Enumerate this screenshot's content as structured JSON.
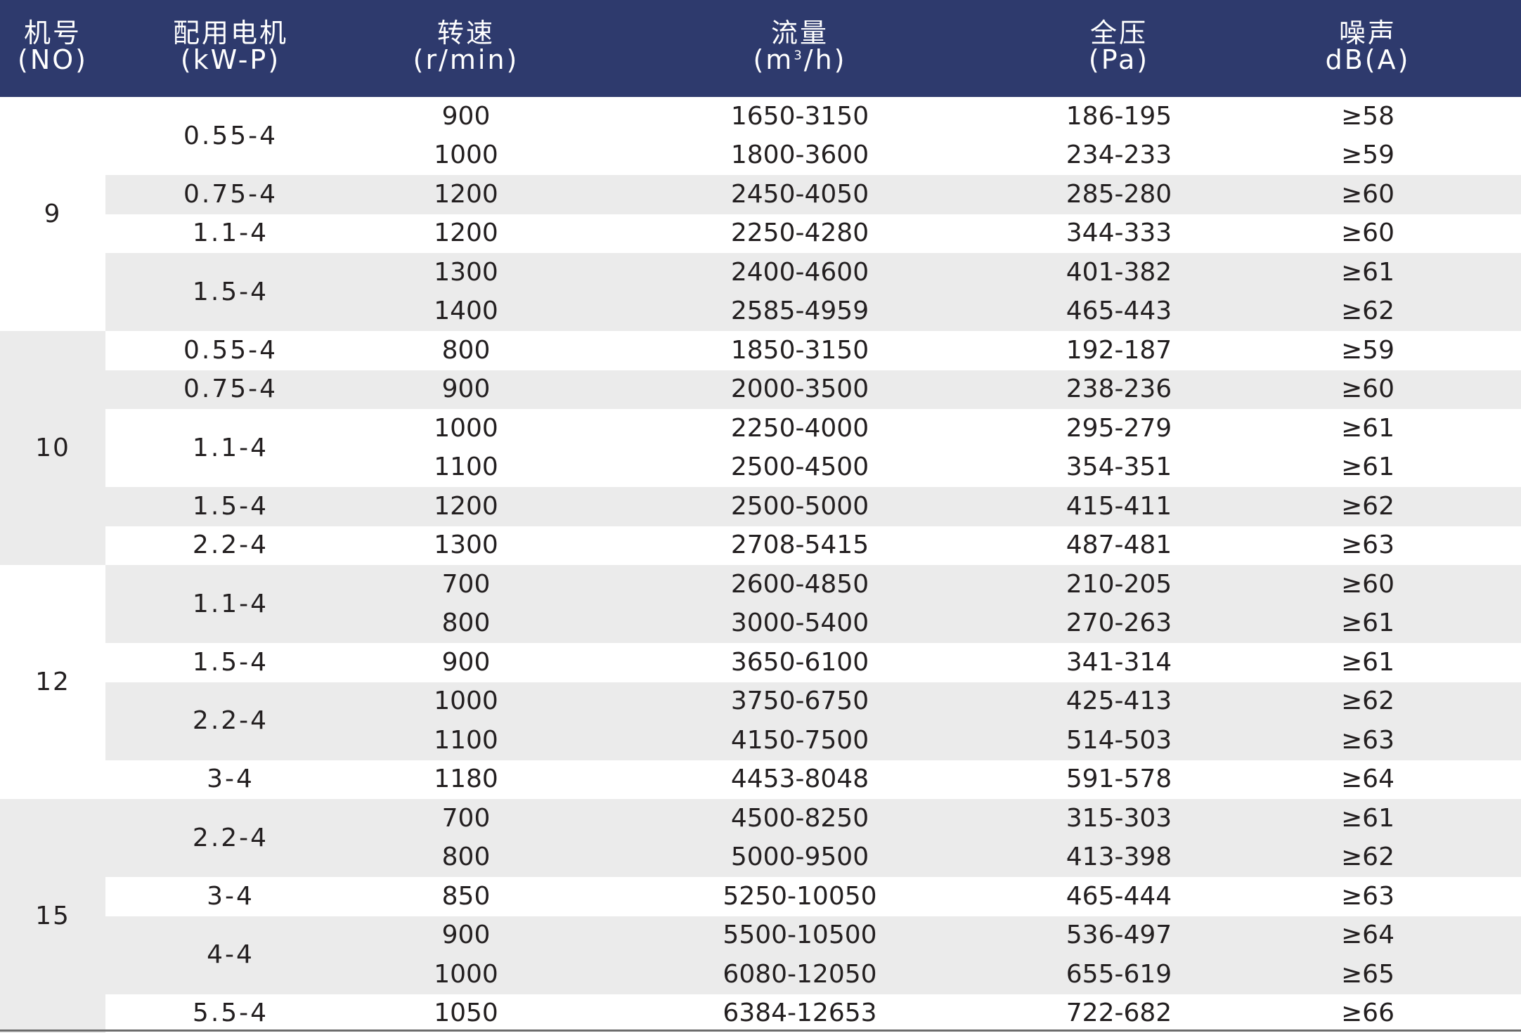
{
  "header": {
    "columns": [
      {
        "line1": "机号",
        "line2": "(NO)"
      },
      {
        "line1": "配用电机",
        "line2": "(kW-P)"
      },
      {
        "line1": "转速",
        "line2": "(r/min)"
      },
      {
        "line1": "流量",
        "line2_pre": "(m",
        "line2_sup": "3",
        "line2_post": "/h)"
      },
      {
        "line1": "全压",
        "line2": "(Pa)"
      },
      {
        "line1": "噪声",
        "line2": "dB(A)"
      }
    ]
  },
  "colors": {
    "header_bg": "#2e3a6d",
    "band_bg": "#ebebeb",
    "text": "#231f20"
  },
  "groups": [
    {
      "no": "9",
      "shaded": false,
      "motors": [
        {
          "motor": "0.55-4",
          "rows": [
            {
              "speed": "900",
              "flow": "1650-3150",
              "pressure": "186-195",
              "noise": "≥58"
            },
            {
              "speed": "1000",
              "flow": "1800-3600",
              "pressure": "234-233",
              "noise": "≥59"
            }
          ]
        },
        {
          "motor": "0.75-4",
          "rows": [
            {
              "speed": "1200",
              "flow": "2450-4050",
              "pressure": "285-280",
              "noise": "≥60"
            }
          ]
        },
        {
          "motor": "1.1-4",
          "rows": [
            {
              "speed": "1200",
              "flow": "2250-4280",
              "pressure": "344-333",
              "noise": "≥60"
            }
          ]
        },
        {
          "motor": "1.5-4",
          "rows": [
            {
              "speed": "1300",
              "flow": "2400-4600",
              "pressure": "401-382",
              "noise": "≥61"
            },
            {
              "speed": "1400",
              "flow": "2585-4959",
              "pressure": "465-443",
              "noise": "≥62"
            }
          ]
        }
      ]
    },
    {
      "no": "10",
      "shaded": true,
      "motors": [
        {
          "motor": "0.55-4",
          "rows": [
            {
              "speed": "800",
              "flow": "1850-3150",
              "pressure": "192-187",
              "noise": "≥59"
            }
          ]
        },
        {
          "motor": "0.75-4",
          "rows": [
            {
              "speed": "900",
              "flow": "2000-3500",
              "pressure": "238-236",
              "noise": "≥60"
            }
          ]
        },
        {
          "motor": "1.1-4",
          "rows": [
            {
              "speed": "1000",
              "flow": "2250-4000",
              "pressure": "295-279",
              "noise": "≥61"
            },
            {
              "speed": "1100",
              "flow": "2500-4500",
              "pressure": "354-351",
              "noise": "≥61"
            }
          ]
        },
        {
          "motor": "1.5-4",
          "rows": [
            {
              "speed": "1200",
              "flow": "2500-5000",
              "pressure": "415-411",
              "noise": "≥62"
            }
          ]
        },
        {
          "motor": "2.2-4",
          "rows": [
            {
              "speed": "1300",
              "flow": "2708-5415",
              "pressure": "487-481",
              "noise": "≥63"
            }
          ]
        }
      ]
    },
    {
      "no": "12",
      "shaded": false,
      "motors": [
        {
          "motor": "1.1-4",
          "rows": [
            {
              "speed": "700",
              "flow": "2600-4850",
              "pressure": "210-205",
              "noise": "≥60"
            },
            {
              "speed": "800",
              "flow": "3000-5400",
              "pressure": "270-263",
              "noise": "≥61"
            }
          ]
        },
        {
          "motor": "1.5-4",
          "rows": [
            {
              "speed": "900",
              "flow": "3650-6100",
              "pressure": "341-314",
              "noise": "≥61"
            }
          ]
        },
        {
          "motor": "2.2-4",
          "rows": [
            {
              "speed": "1000",
              "flow": "3750-6750",
              "pressure": "425-413",
              "noise": "≥62"
            },
            {
              "speed": "1100",
              "flow": "4150-7500",
              "pressure": "514-503",
              "noise": "≥63"
            }
          ]
        },
        {
          "motor": "3-4",
          "rows": [
            {
              "speed": "1180",
              "flow": "4453-8048",
              "pressure": "591-578",
              "noise": "≥64"
            }
          ]
        }
      ]
    },
    {
      "no": "15",
      "shaded": true,
      "motors": [
        {
          "motor": "2.2-4",
          "rows": [
            {
              "speed": "700",
              "flow": "4500-8250",
              "pressure": "315-303",
              "noise": "≥61"
            },
            {
              "speed": "800",
              "flow": "5000-9500",
              "pressure": "413-398",
              "noise": "≥62"
            }
          ]
        },
        {
          "motor": "3-4",
          "rows": [
            {
              "speed": "850",
              "flow": "5250-10050",
              "pressure": "465-444",
              "noise": "≥63"
            }
          ]
        },
        {
          "motor": "4-4",
          "rows": [
            {
              "speed": "900",
              "flow": "5500-10500",
              "pressure": "536-497",
              "noise": "≥64"
            },
            {
              "speed": "1000",
              "flow": "6080-12050",
              "pressure": "655-619",
              "noise": "≥65"
            }
          ]
        },
        {
          "motor": "5.5-4",
          "rows": [
            {
              "speed": "1050",
              "flow": "6384-12653",
              "pressure": "722-682",
              "noise": "≥66"
            }
          ]
        }
      ]
    }
  ]
}
